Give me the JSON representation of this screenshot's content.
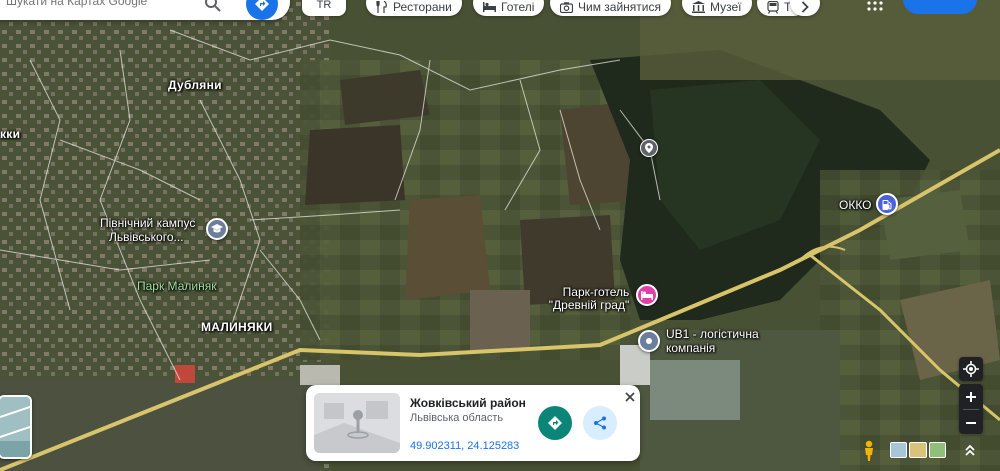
{
  "search": {
    "placeholder": "Шукати на Картах Google"
  },
  "toolbar": {
    "translate_label": "TR",
    "chips": [
      {
        "label": "Ресторани",
        "icon": "fork-knife-icon"
      },
      {
        "label": "Готелі",
        "icon": "bed-icon"
      },
      {
        "label": "Чим зайнятися",
        "icon": "camera-icon"
      },
      {
        "label": "Музеї",
        "icon": "museum-icon"
      },
      {
        "label": "Т",
        "icon": "train-icon"
      }
    ]
  },
  "map": {
    "places": {
      "dubliany": "Дубляни",
      "kky": "кки",
      "north_campus_line1": "Північний кампус",
      "north_campus_line2": "Львівського...",
      "park": "Парк Малиняк",
      "maliniaky": "МАЛИНЯКИ",
      "hotel_line1": "Парк-готель",
      "hotel_line2": "\"Древній град\"",
      "ub1_line1": "UB1 - логістична",
      "ub1_line2": "компанія",
      "okko": "ОККО"
    }
  },
  "card": {
    "title": "Жовківський район",
    "subtitle": "Львівська область",
    "coords": "49.902311, 24.125283"
  },
  "colors": {
    "accent": "#1a73e8",
    "directions": "#0b8577",
    "hotel_pin": "#e140a8",
    "gas_pin": "#4a63d8",
    "school_pin": "#6b7f9b",
    "road": "#d8c46a"
  }
}
